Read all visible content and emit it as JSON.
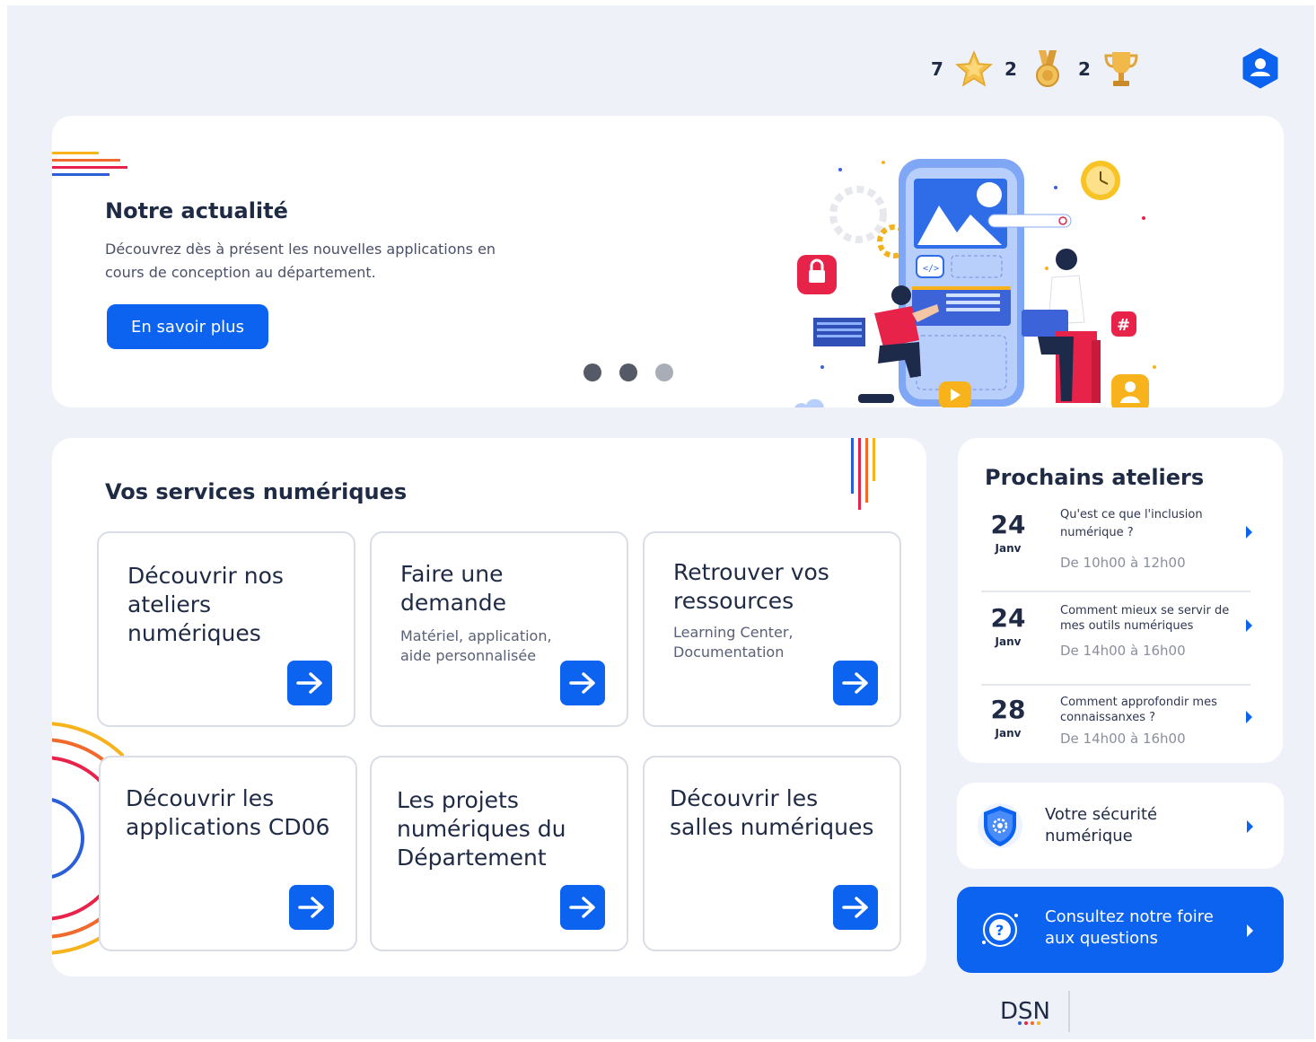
{
  "stats": {
    "stars": "7",
    "medals": "2",
    "trophies": "2"
  },
  "hero": {
    "title": "Notre actualité",
    "description": "Découvrez dès à présent les nouvelles applications en cours de conception au département.",
    "button_label": "En savoir plus",
    "carousel_active_index": 2
  },
  "services": {
    "title": "Vos services numériques",
    "tiles": [
      {
        "title": "Découvrir nos ateliers numériques",
        "subtitle": ""
      },
      {
        "title": "Faire une demande",
        "subtitle": "Matériel, application, aide personnalisée"
      },
      {
        "title": "Retrouver vos ressources",
        "subtitle": "Learning Center, Documentation"
      },
      {
        "title": "Découvrir les applications CD06",
        "subtitle": ""
      },
      {
        "title": "Les projets numériques du Département",
        "subtitle": ""
      },
      {
        "title": "Découvrir les salles numériques",
        "subtitle": ""
      }
    ]
  },
  "ateliers": {
    "title": "Prochains ateliers",
    "items": [
      {
        "day": "24",
        "month": "Janv",
        "title": "Qu'est ce que l'inclusion numérique ?",
        "time": "De 10h00 à 12h00"
      },
      {
        "day": "24",
        "month": "Janv",
        "title": "Comment mieux se servir de mes outils numériques",
        "time": "De 14h00 à 16h00"
      },
      {
        "day": "28",
        "month": "Janv",
        "title": "Comment approfondir mes connaissanxes ?",
        "time": "De 14h00 à 16h00"
      }
    ]
  },
  "security": {
    "label": "Votre sécurité numérique"
  },
  "faq": {
    "label": "Consultez notre foire aux questions"
  },
  "footer": {
    "logo_text": "DSN"
  },
  "colors": {
    "primary": "#0b63f0",
    "background": "#eef1f8",
    "text": "#1f2a44"
  },
  "icons": {
    "star": "star-icon",
    "medal": "medal-icon",
    "trophy": "trophy-icon",
    "user": "user-icon",
    "arrow": "arrow-right-icon",
    "shield": "shield-icon",
    "help": "help-icon",
    "chevron": "chevron-right-icon"
  }
}
